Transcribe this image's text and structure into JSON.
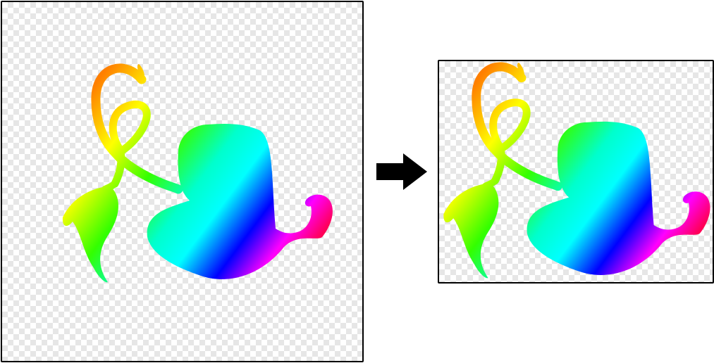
{
  "diagram": {
    "panels": [
      {
        "role": "original",
        "background": "transparent-checkerboard"
      },
      {
        "role": "trimmed",
        "background": "transparent-checkerboard"
      }
    ],
    "connector": "right-arrow-icon",
    "artwork": "rainbow-gradient-heart-with-curly-vine",
    "colors": {
      "frame": "#000000",
      "arrow": "#000000",
      "checker_light": "#ffffff",
      "checker_dark": "#e6e6e6"
    }
  }
}
